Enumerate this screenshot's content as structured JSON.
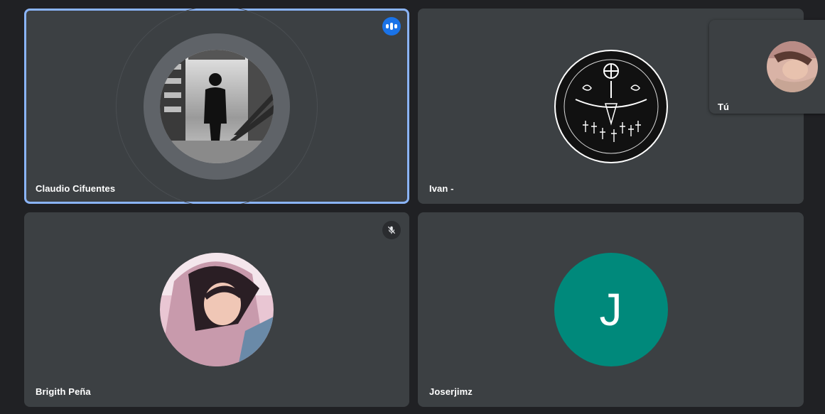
{
  "participants": [
    {
      "name": "Claudio Cifuentes",
      "state": "speaking"
    },
    {
      "name": "Ivan -"
    },
    {
      "name": "Brigith Peña",
      "state": "muted"
    },
    {
      "name": "Joserjimz",
      "initial": "J",
      "avatar_color": "#00897b"
    }
  ],
  "self": {
    "name": "Tú"
  },
  "colors": {
    "background": "#202124",
    "tile": "#3c4043",
    "active_border": "#8ab4f8",
    "speaking_badge": "#1a73e8"
  }
}
